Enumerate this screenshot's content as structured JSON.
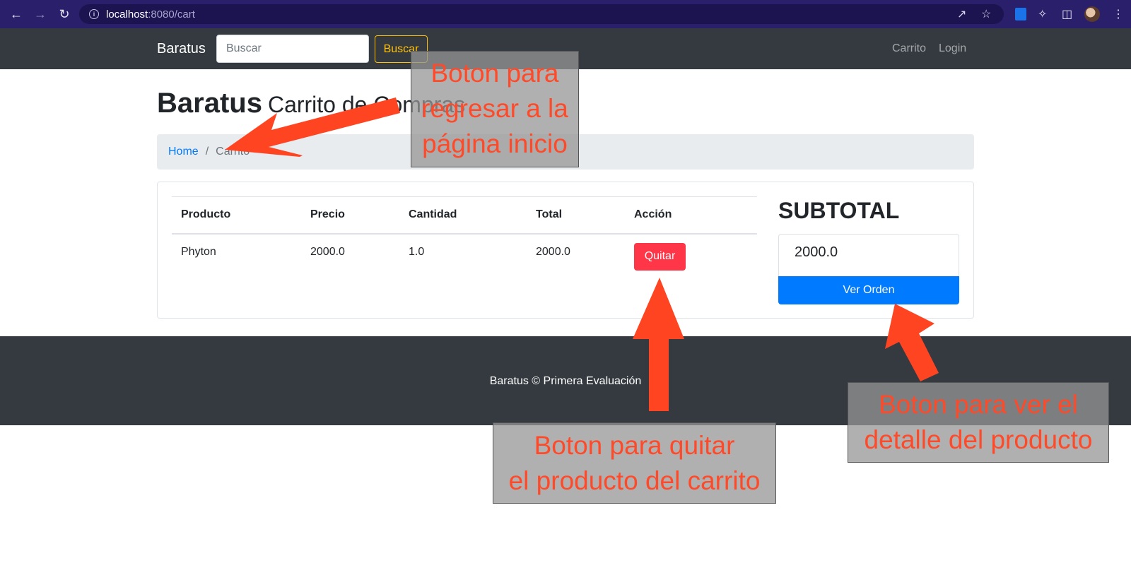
{
  "browser": {
    "url_host": "localhost",
    "url_path": ":8080/cart",
    "icons": [
      "back-icon",
      "forward-icon",
      "reload-icon",
      "info-icon",
      "share-icon",
      "star-icon",
      "extensions-icon",
      "side-panel-icon",
      "menu-icon"
    ]
  },
  "navbar": {
    "brand": "Baratus",
    "search_placeholder": "Buscar",
    "search_button": "Buscar",
    "links": [
      "Carrito",
      "Login"
    ]
  },
  "main": {
    "title": "Baratus",
    "subtitle": "Carrito de Compras",
    "breadcrumb": {
      "home": "Home",
      "current": "Carrito"
    }
  },
  "cart": {
    "columns": [
      "Producto",
      "Precio",
      "Cantidad",
      "Total",
      "Acción"
    ],
    "rows": [
      {
        "producto": "Phyton",
        "precio": "2000.0",
        "cantidad": "1.0",
        "total": "2000.0",
        "accion": "Quitar"
      }
    ]
  },
  "summary": {
    "title": "SUBTOTAL",
    "value": "2000.0",
    "button": "Ver Orden"
  },
  "footer": {
    "text": "Baratus © Primera Evaluación"
  },
  "annotations": {
    "home_note": [
      "Boton para",
      "regresar a la",
      "página inicio"
    ],
    "remove_note": [
      "Boton para quitar",
      "el producto del carrito"
    ],
    "order_note": [
      "Boton para ver el",
      "detalle del producto"
    ],
    "arrow_color": "#ff4422"
  }
}
